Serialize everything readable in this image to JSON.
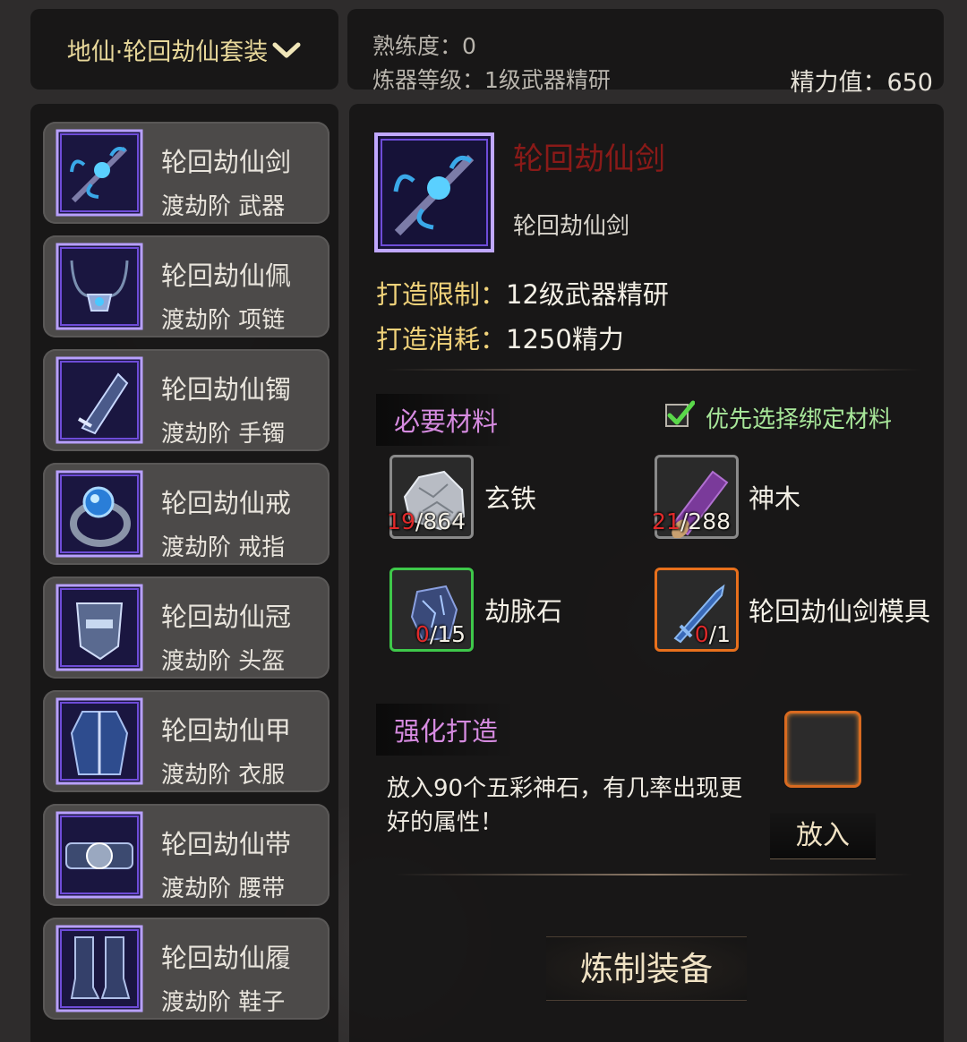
{
  "header": {
    "set_name": "地仙·轮回劫仙套装",
    "proficiency": "熟练度：0",
    "forge_level": "炼器等级：1级武器精研",
    "energy": "精力值：650"
  },
  "equipment_list": [
    {
      "name": "轮回劫仙剑",
      "subtitle": "渡劫阶 武器",
      "icon": "sword-icon"
    },
    {
      "name": "轮回劫仙佩",
      "subtitle": "渡劫阶 项链",
      "icon": "necklace-icon"
    },
    {
      "name": "轮回劫仙镯",
      "subtitle": "渡劫阶 手镯",
      "icon": "bracelet-icon"
    },
    {
      "name": "轮回劫仙戒",
      "subtitle": "渡劫阶 戒指",
      "icon": "ring-icon"
    },
    {
      "name": "轮回劫仙冠",
      "subtitle": "渡劫阶 头盔",
      "icon": "helmet-icon"
    },
    {
      "name": "轮回劫仙甲",
      "subtitle": "渡劫阶 衣服",
      "icon": "armor-icon"
    },
    {
      "name": "轮回劫仙带",
      "subtitle": "渡劫阶 腰带",
      "icon": "belt-icon"
    },
    {
      "name": "轮回劫仙履",
      "subtitle": "渡劫阶 鞋子",
      "icon": "boots-icon"
    }
  ],
  "detail": {
    "title": "轮回劫仙剑",
    "subtitle": "轮回劫仙剑",
    "limit_label": "打造限制：",
    "limit_value": "12级武器精研",
    "cost_label": "打造消耗：",
    "cost_value": "1250精力"
  },
  "materials": {
    "section_title": "必要材料",
    "prefer_bound_label": "优先选择绑定材料",
    "prefer_bound_checked": true,
    "items": [
      {
        "name": "玄铁",
        "have": "19",
        "need": "/864",
        "icon": "iron-ore-icon",
        "rarity_color": "#8a8a8a"
      },
      {
        "name": "神木",
        "have": "21",
        "need": "/288",
        "icon": "wood-log-icon",
        "rarity_color": "#8a8a8a"
      },
      {
        "name": "劫脉石",
        "have": "0",
        "need": "/15",
        "icon": "vein-stone-icon",
        "rarity_color": "#3ec84a"
      },
      {
        "name": "轮回劫仙剑模具",
        "have": "0",
        "need": "/1",
        "icon": "sword-mold-icon",
        "rarity_color": "#e8701c"
      }
    ]
  },
  "enhance": {
    "section_title": "强化打造",
    "description": "放入90个五彩神石，有几率出现更好的属性！",
    "put_button": "放入"
  },
  "craft_button": "炼制装备"
}
